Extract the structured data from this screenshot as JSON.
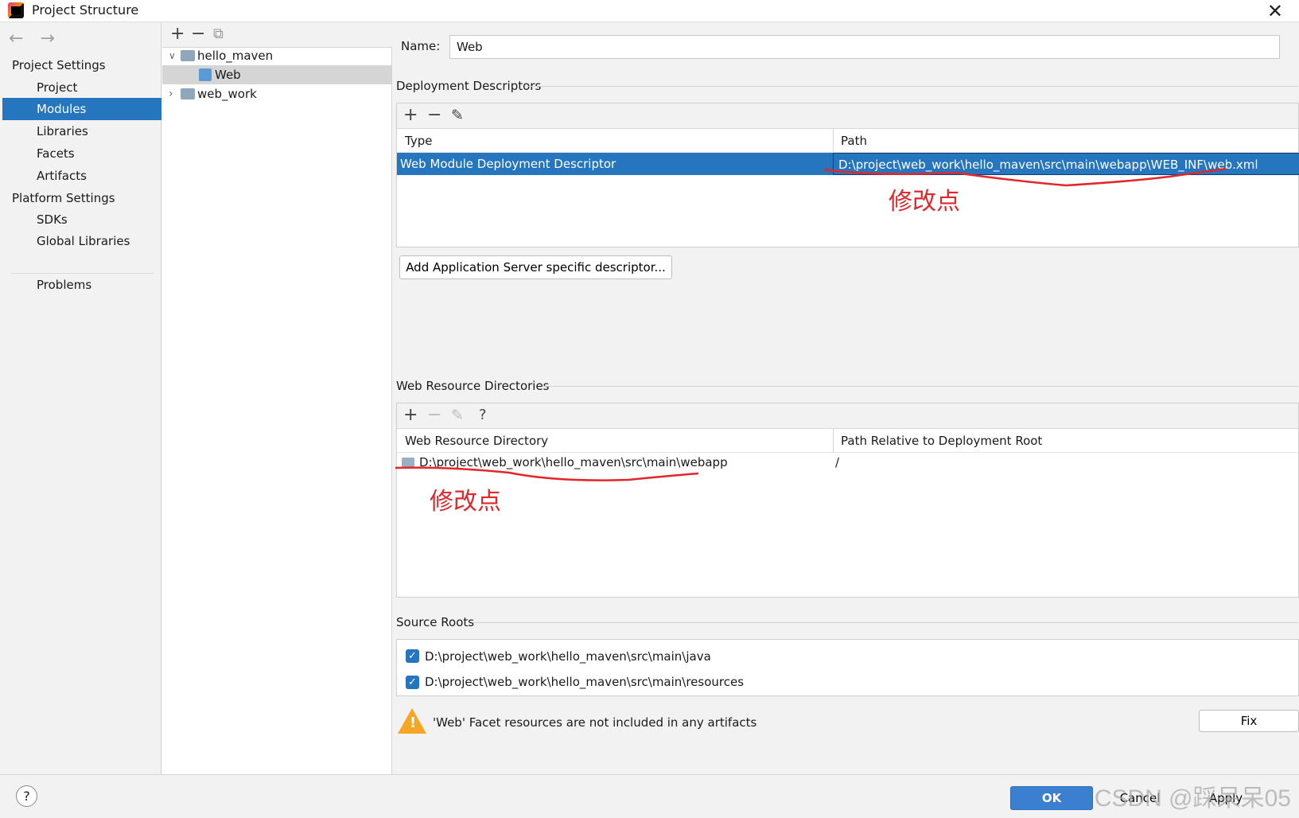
{
  "window": {
    "title": "Project Structure",
    "close_label": "✕"
  },
  "nav": {
    "back": "←",
    "forward": "→",
    "project_settings_header": "Project Settings",
    "project_items": [
      "Project",
      "Modules",
      "Libraries",
      "Facets",
      "Artifacts"
    ],
    "platform_settings_header": "Platform Settings",
    "platform_items": [
      "SDKs",
      "Global Libraries"
    ],
    "problems": "Problems",
    "selected": "Modules"
  },
  "tree": {
    "toolbar": {
      "add": "+",
      "remove": "−",
      "copy": "⧉"
    },
    "nodes": [
      {
        "label": "hello_maven",
        "expanded": true
      },
      {
        "label": "Web",
        "selected": true
      },
      {
        "label": "web_work",
        "expanded": false
      }
    ]
  },
  "facet": {
    "name_label": "Name:",
    "name_value": "Web",
    "deployment_descriptors": {
      "title": "Deployment Descriptors",
      "toolbar": {
        "add": "+",
        "remove": "−",
        "edit": "✎"
      },
      "columns": [
        "Type",
        "Path"
      ],
      "rows": [
        {
          "type": "Web Module Deployment Descriptor",
          "path": "D:\\project\\web_work\\hello_maven\\src\\main\\webapp\\WEB_INF\\web.xml"
        }
      ],
      "add_server_button": "Add Application Server specific descriptor..."
    },
    "web_resource_directories": {
      "title": "Web Resource Directories",
      "toolbar": {
        "add": "+",
        "remove": "−",
        "edit": "✎",
        "help": "?"
      },
      "columns": [
        "Web Resource Directory",
        "Path Relative to Deployment Root"
      ],
      "rows": [
        {
          "directory": "D:\\project\\web_work\\hello_maven\\src\\main\\webapp",
          "relative": "/"
        }
      ]
    },
    "source_roots": {
      "title": "Source Roots",
      "items": [
        {
          "path": "D:\\project\\web_work\\hello_maven\\src\\main\\java",
          "checked": true
        },
        {
          "path": "D:\\project\\web_work\\hello_maven\\src\\main\\resources",
          "checked": true
        }
      ]
    },
    "warning": {
      "text": "'Web' Facet resources are not included in any artifacts",
      "fix_button": "Fix"
    }
  },
  "footer": {
    "help": "?",
    "ok": "OK",
    "cancel": "Cancel",
    "apply": "Apply"
  },
  "annotations": {
    "mark1": "修改点",
    "mark2": "修改点",
    "color": "#e3262a"
  },
  "watermark": "CSDN @踩呆呆05",
  "colors": {
    "selection": "#2675bf",
    "background": "#f2f2f2",
    "warning": "#f5a623"
  }
}
